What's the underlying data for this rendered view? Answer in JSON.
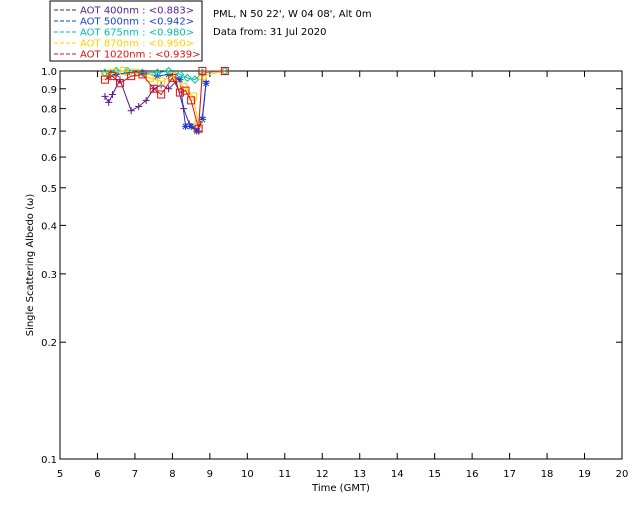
{
  "info": {
    "location": "PML, N 50 22', W 04 08', Alt 0m",
    "date": "Data from: 31 Jul 2020"
  },
  "chart_data": {
    "type": "line",
    "xlabel": "Time (GMT)",
    "ylabel": "Single Scattering Albedo (ω)",
    "xlim": [
      5,
      20
    ],
    "ylim": [
      0.1,
      1.0
    ],
    "yscale": "log",
    "x_ticks": [
      "5",
      "6",
      "7",
      "8",
      "9",
      "10",
      "11",
      "12",
      "13",
      "14",
      "15",
      "16",
      "17",
      "18",
      "19",
      "20"
    ],
    "y_ticks": [
      {
        "v": 1.0,
        "label": "1.0"
      },
      {
        "v": 0.9,
        "label": "0.9"
      },
      {
        "v": 0.8,
        "label": "0.8"
      },
      {
        "v": 0.7,
        "label": "0.7"
      },
      {
        "v": 0.6,
        "label": "0.6"
      },
      {
        "v": 0.5,
        "label": "0.5"
      },
      {
        "v": 0.4,
        "label": "0.4"
      },
      {
        "v": 0.3,
        "label": "0.3"
      },
      {
        "v": 0.2,
        "label": "0.2"
      },
      {
        "v": 0.1,
        "label": "0.1"
      }
    ],
    "series": [
      {
        "name": "AOT  400nm : <0.883>",
        "color": "#5a1a8c",
        "marker": "plus",
        "x": [
          6.2,
          6.3,
          6.4,
          6.6,
          6.9,
          7.1,
          7.3,
          7.5,
          7.7,
          7.9,
          8.1,
          8.3,
          8.45,
          8.6,
          8.7,
          8.8,
          8.9
        ],
        "y": [
          0.86,
          0.83,
          0.87,
          0.95,
          0.79,
          0.81,
          0.84,
          0.9,
          0.92,
          0.9,
          0.94,
          0.8,
          0.73,
          0.71,
          0.7,
          0.76,
          0.94
        ]
      },
      {
        "name": "AOT  500nm : <0.942>",
        "color": "#1a3fd0",
        "marker": "star",
        "x": [
          6.3,
          6.5,
          6.8,
          7.2,
          7.6,
          7.9,
          8.2,
          8.35,
          8.5,
          8.65,
          8.8,
          8.9
        ],
        "y": [
          0.97,
          0.98,
          0.99,
          0.99,
          0.97,
          0.98,
          0.95,
          0.72,
          0.72,
          0.7,
          0.75,
          0.93
        ]
      },
      {
        "name": "AOT  675nm : <0.980>",
        "color": "#00bfa5",
        "marker": "diamond",
        "x": [
          6.2,
          6.5,
          6.8,
          7.2,
          7.6,
          7.9,
          8.2,
          8.4,
          8.6,
          8.8,
          9.4
        ],
        "y": [
          0.99,
          1.0,
          1.0,
          0.99,
          0.99,
          1.0,
          0.98,
          0.96,
          0.95,
          0.99,
          1.0
        ]
      },
      {
        "name": "AOT  870nm : <0.950>",
        "color": "#ffd000",
        "marker": "square",
        "x": [
          6.2,
          6.4,
          6.7,
          7.0,
          7.4,
          7.7,
          8.0,
          8.3,
          8.55,
          8.7,
          8.8,
          9.4
        ],
        "y": [
          0.97,
          0.99,
          1.0,
          0.99,
          0.96,
          0.94,
          0.97,
          0.91,
          0.86,
          0.73,
          0.97,
          1.0
        ]
      },
      {
        "name": "AOT 1020nm : <0.939>",
        "color": "#e01010",
        "marker": "square",
        "x": [
          6.2,
          6.4,
          6.6,
          6.9,
          7.2,
          7.5,
          7.7,
          8.0,
          8.2,
          8.35,
          8.5,
          8.7,
          8.8,
          9.4
        ],
        "y": [
          0.95,
          0.97,
          0.93,
          0.97,
          0.98,
          0.9,
          0.87,
          0.96,
          0.88,
          0.89,
          0.84,
          0.71,
          1.0,
          1.0
        ]
      }
    ]
  }
}
